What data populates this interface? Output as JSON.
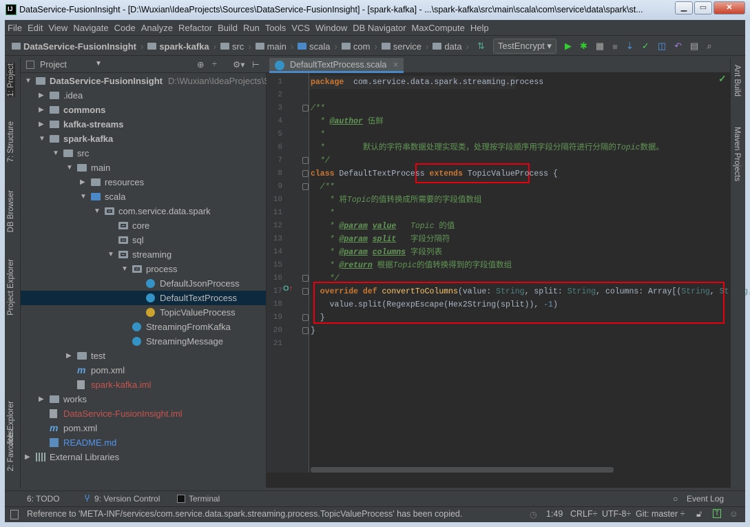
{
  "window": {
    "title": "DataService-FusionInsight - [D:\\Wuxian\\IdeaProjects\\Sources\\DataService-FusionInsight] - [spark-kafka] - ...\\spark-kafka\\src\\main\\scala\\com\\service\\data\\spark\\st...",
    "icon": "IJ"
  },
  "menu": [
    "File",
    "Edit",
    "View",
    "Navigate",
    "Code",
    "Analyze",
    "Refactor",
    "Build",
    "Run",
    "Tools",
    "VCS",
    "Window",
    "DB Navigator",
    "MaxCompute",
    "Help"
  ],
  "breadcrumb": [
    {
      "label": "DataService-FusionInsight",
      "bold": true
    },
    {
      "label": "spark-kafka",
      "bold": true
    },
    {
      "label": "src"
    },
    {
      "label": "main"
    },
    {
      "label": "scala",
      "blue": true
    },
    {
      "label": "com"
    },
    {
      "label": "service"
    },
    {
      "label": "data"
    }
  ],
  "run_config": "TestEncrypt ▾",
  "left_tabs": [
    "1: Project",
    "7: Structure",
    "DB Browser",
    "Project Explorer",
    "Job Explorer",
    "2: Favorites"
  ],
  "right_tabs": [
    "Ant Build",
    "Maven Projects"
  ],
  "project": {
    "title": "Project",
    "tree": [
      {
        "label": "DataService-FusionInsight",
        "level": 0,
        "arrow": "▼",
        "icon": "folder",
        "style": "bold",
        "path": "D:\\Wuxian\\IdeaProjects\\S"
      },
      {
        "label": ".idea",
        "level": 1,
        "arrow": "▶",
        "icon": "folder"
      },
      {
        "label": "commons",
        "level": 1,
        "arrow": "▶",
        "icon": "folder",
        "style": "bold"
      },
      {
        "label": "kafka-streams",
        "level": 1,
        "arrow": "▶",
        "icon": "folder",
        "style": "bold"
      },
      {
        "label": "spark-kafka",
        "level": 1,
        "arrow": "▼",
        "icon": "folder",
        "style": "bold"
      },
      {
        "label": "src",
        "level": 2,
        "arrow": "▼",
        "icon": "folder"
      },
      {
        "label": "main",
        "level": 3,
        "arrow": "▼",
        "icon": "folder"
      },
      {
        "label": "resources",
        "level": 4,
        "arrow": "▶",
        "icon": "folder"
      },
      {
        "label": "scala",
        "level": 4,
        "arrow": "▼",
        "icon": "srcfolder"
      },
      {
        "label": "com.service.data.spark",
        "level": 5,
        "arrow": "▼",
        "icon": "pkg"
      },
      {
        "label": "core",
        "level": 6,
        "arrow": "",
        "icon": "pkg"
      },
      {
        "label": "sql",
        "level": 6,
        "arrow": "",
        "icon": "pkg"
      },
      {
        "label": "streaming",
        "level": 6,
        "arrow": "▼",
        "icon": "pkg"
      },
      {
        "label": "process",
        "level": 7,
        "arrow": "▼",
        "icon": "pkg"
      },
      {
        "label": "DefaultJsonProcess",
        "level": 8,
        "arrow": "",
        "icon": "scala"
      },
      {
        "label": "DefaultTextProcess",
        "level": 8,
        "arrow": "",
        "icon": "scala",
        "selected": true
      },
      {
        "label": "TopicValueProcess",
        "level": 8,
        "arrow": "",
        "icon": "trait"
      },
      {
        "label": "StreamingFromKafka",
        "level": 7,
        "arrow": "",
        "icon": "scala"
      },
      {
        "label": "StreamingMessage",
        "level": 7,
        "arrow": "",
        "icon": "scala"
      },
      {
        "label": "test",
        "level": 3,
        "arrow": "▶",
        "icon": "folder"
      },
      {
        "label": "pom.xml",
        "level": 3,
        "arrow": "",
        "icon": "maven"
      },
      {
        "label": "spark-kafka.iml",
        "level": 3,
        "arrow": "",
        "icon": "file",
        "style": "red"
      },
      {
        "label": "works",
        "level": 1,
        "arrow": "▶",
        "icon": "folder"
      },
      {
        "label": "DataService-FusionInsight.iml",
        "level": 1,
        "arrow": "",
        "icon": "file",
        "style": "red"
      },
      {
        "label": "pom.xml",
        "level": 1,
        "arrow": "",
        "icon": "maven"
      },
      {
        "label": "README.md",
        "level": 1,
        "arrow": "",
        "icon": "md",
        "style": "blue"
      },
      {
        "label": "External Libraries",
        "level": 0,
        "arrow": "▶",
        "icon": "lib"
      }
    ]
  },
  "editor": {
    "tab": "DefaultTextProcess.scala",
    "lines": [
      [
        [
          "k",
          "package"
        ],
        [
          "",
          "  com.service.data.spark.streaming.process"
        ]
      ],
      [],
      [
        [
          "c",
          "/**"
        ]
      ],
      [
        [
          "c",
          "  * "
        ],
        [
          "tag",
          "@author"
        ],
        [
          "cz",
          " 伍鲜"
        ]
      ],
      [
        [
          "c",
          "  *"
        ]
      ],
      [
        [
          "c",
          "  *        "
        ],
        [
          "cz",
          "默认的字符串数据处理实现类，处理按字段顺序用字段分隔符进行分隔的"
        ],
        [
          "c",
          "Topic"
        ],
        [
          "cz",
          "数据。"
        ]
      ],
      [
        [
          "c",
          "  */"
        ]
      ],
      [
        [
          "k",
          "class"
        ],
        [
          "",
          " DefaultTextProcess "
        ],
        [
          "k",
          "extends"
        ],
        [
          "",
          " TopicValueProcess {"
        ]
      ],
      [
        [
          "c",
          "  /**"
        ]
      ],
      [
        [
          "c",
          "    * "
        ],
        [
          "cz",
          "将"
        ],
        [
          "c",
          "Topic"
        ],
        [
          "cz",
          "的值转换成所需要的字段值数组"
        ]
      ],
      [
        [
          "c",
          "    *"
        ]
      ],
      [
        [
          "c",
          "    * "
        ],
        [
          "tag",
          "@param"
        ],
        [
          "c",
          " "
        ],
        [
          "tag",
          "value"
        ],
        [
          "c",
          "   Topic "
        ],
        [
          "cz",
          "的值"
        ]
      ],
      [
        [
          "c",
          "    * "
        ],
        [
          "tag",
          "@param"
        ],
        [
          "c",
          " "
        ],
        [
          "tag",
          "split"
        ],
        [
          "cz",
          "   字段分隔符"
        ]
      ],
      [
        [
          "c",
          "    * "
        ],
        [
          "tag",
          "@param"
        ],
        [
          "c",
          " "
        ],
        [
          "tag",
          "columns"
        ],
        [
          "cz",
          " 字段列表"
        ]
      ],
      [
        [
          "c",
          "    * "
        ],
        [
          "tag",
          "@return"
        ],
        [
          "cz",
          " 根据"
        ],
        [
          "c",
          "Topic"
        ],
        [
          "cz",
          "的值转换得到的字段值数组"
        ]
      ],
      [
        [
          "c",
          "    */"
        ]
      ],
      [
        [
          "k",
          "  override def "
        ],
        [
          "fn",
          "convertToColumns"
        ],
        [
          "",
          "(value: "
        ],
        [
          "ty",
          "String"
        ],
        [
          "",
          ", split: "
        ],
        [
          "ty",
          "String"
        ],
        [
          "",
          ", columns: Array[("
        ],
        [
          "ty",
          "String"
        ],
        [
          "",
          ", "
        ],
        [
          "ty",
          "String"
        ],
        [
          "",
          ", "
        ],
        [
          "k",
          "Int"
        ],
        [
          "",
          ", S"
        ]
      ],
      [
        [
          "",
          "    value.split(RegexpEscape(Hex2String(split)), "
        ],
        [
          "num",
          "-1"
        ],
        [
          "",
          ")"
        ]
      ],
      [
        [
          "",
          "  }"
        ]
      ],
      [
        [
          "",
          "}"
        ]
      ],
      []
    ]
  },
  "bottom_tools": {
    "todo": "6: TODO",
    "vcs": "9: Version Control",
    "terminal": "Terminal",
    "event_log": "Event Log"
  },
  "status": {
    "message": "Reference to 'META-INF/services/com.service.data.spark.streaming.process.TopicValueProcess' has been copied.",
    "position": "1:49",
    "line_sep": "CRLF÷",
    "encoding": "UTF-8÷",
    "vcs": "Git: master ÷"
  },
  "colors": {
    "keyword": "#cc7832",
    "comment": "#629755",
    "selection": "#0d293e",
    "highlight": "#e8000f"
  }
}
